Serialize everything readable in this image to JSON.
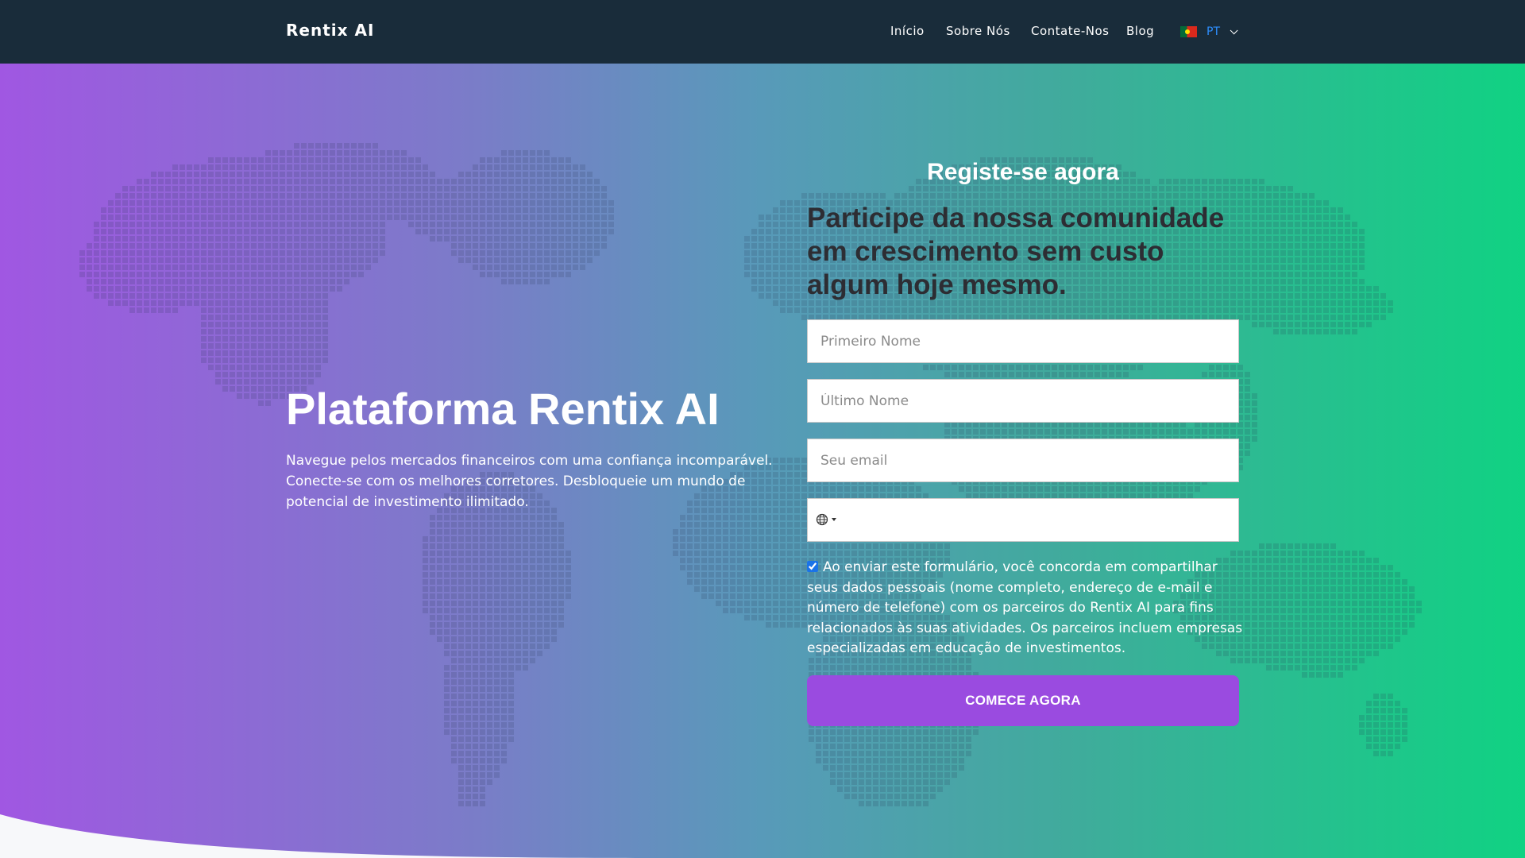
{
  "nav": {
    "brand": "Rentix AI",
    "links": [
      {
        "label": "Início"
      },
      {
        "label": "Sobre Nós"
      },
      {
        "label": "Contate-Nos"
      },
      {
        "label": "Blog"
      }
    ],
    "language": {
      "code": "PT",
      "flag": "portugal-flag-icon"
    }
  },
  "hero": {
    "title_prefix": "Plataforma",
    "title_brand": "Rentix AI",
    "description": "Navegue pelos mercados financeiros com uma confiança incomparável. Conecte-se com os melhores corretores. Desbloqueie um mundo de potencial de investimento ilimitado."
  },
  "form": {
    "title": "Registe-se agora",
    "headline": "Participe da nossa comunidade em crescimento sem custo algum hoje mesmo.",
    "first_name": {
      "placeholder": "Primeiro Nome",
      "value": ""
    },
    "last_name": {
      "placeholder": "Último Nome",
      "value": ""
    },
    "email": {
      "placeholder": "Seu email",
      "value": ""
    },
    "phone": {
      "value": "",
      "country_icon": "globe-icon"
    },
    "consent": {
      "checked": true,
      "text": "Ao enviar este formulário, você concorda em compartilhar seus dados pessoais (nome completo, endereço de e-mail e número de telefone) com os parceiros do Rentix AI para fins relacionados às suas atividades. Os parceiros incluem empresas especializadas em educação de investimentos."
    },
    "submit_label": "COMECE AGORA"
  },
  "colors": {
    "navbar": "#192c3a",
    "gradient_start": "#a057e2",
    "gradient_end": "#10d283",
    "cta": "#9a4be0",
    "headline": "#2d2d33",
    "lang_code": "#2d8fff"
  }
}
